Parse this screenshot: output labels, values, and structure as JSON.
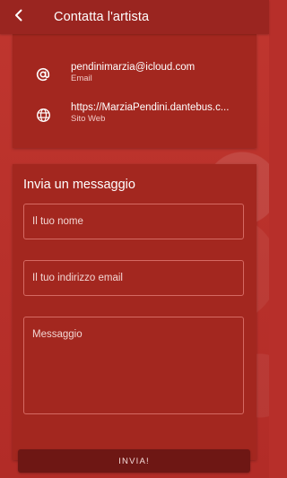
{
  "header": {
    "title": "Contatta l'artista",
    "back_icon": "arrow-back-icon"
  },
  "contact": {
    "email": {
      "value": "pendinimarzia@icloud.com",
      "label": "Email",
      "icon": "at-sign-icon"
    },
    "website": {
      "value": "https://MarziaPendini.dantebus.c...",
      "label": "Sito Web",
      "icon": "globe-icon"
    }
  },
  "form": {
    "heading": "Invia un messaggio",
    "name_placeholder": "Il tuo nome",
    "email_placeholder": "Il tuo indirizzo email",
    "message_placeholder": "Messaggio",
    "submit_label": "INVIA!"
  },
  "colors": {
    "background": "#b72f2a",
    "appbar": "#9a2520",
    "card": "#a3271f",
    "button": "#6e1714"
  }
}
